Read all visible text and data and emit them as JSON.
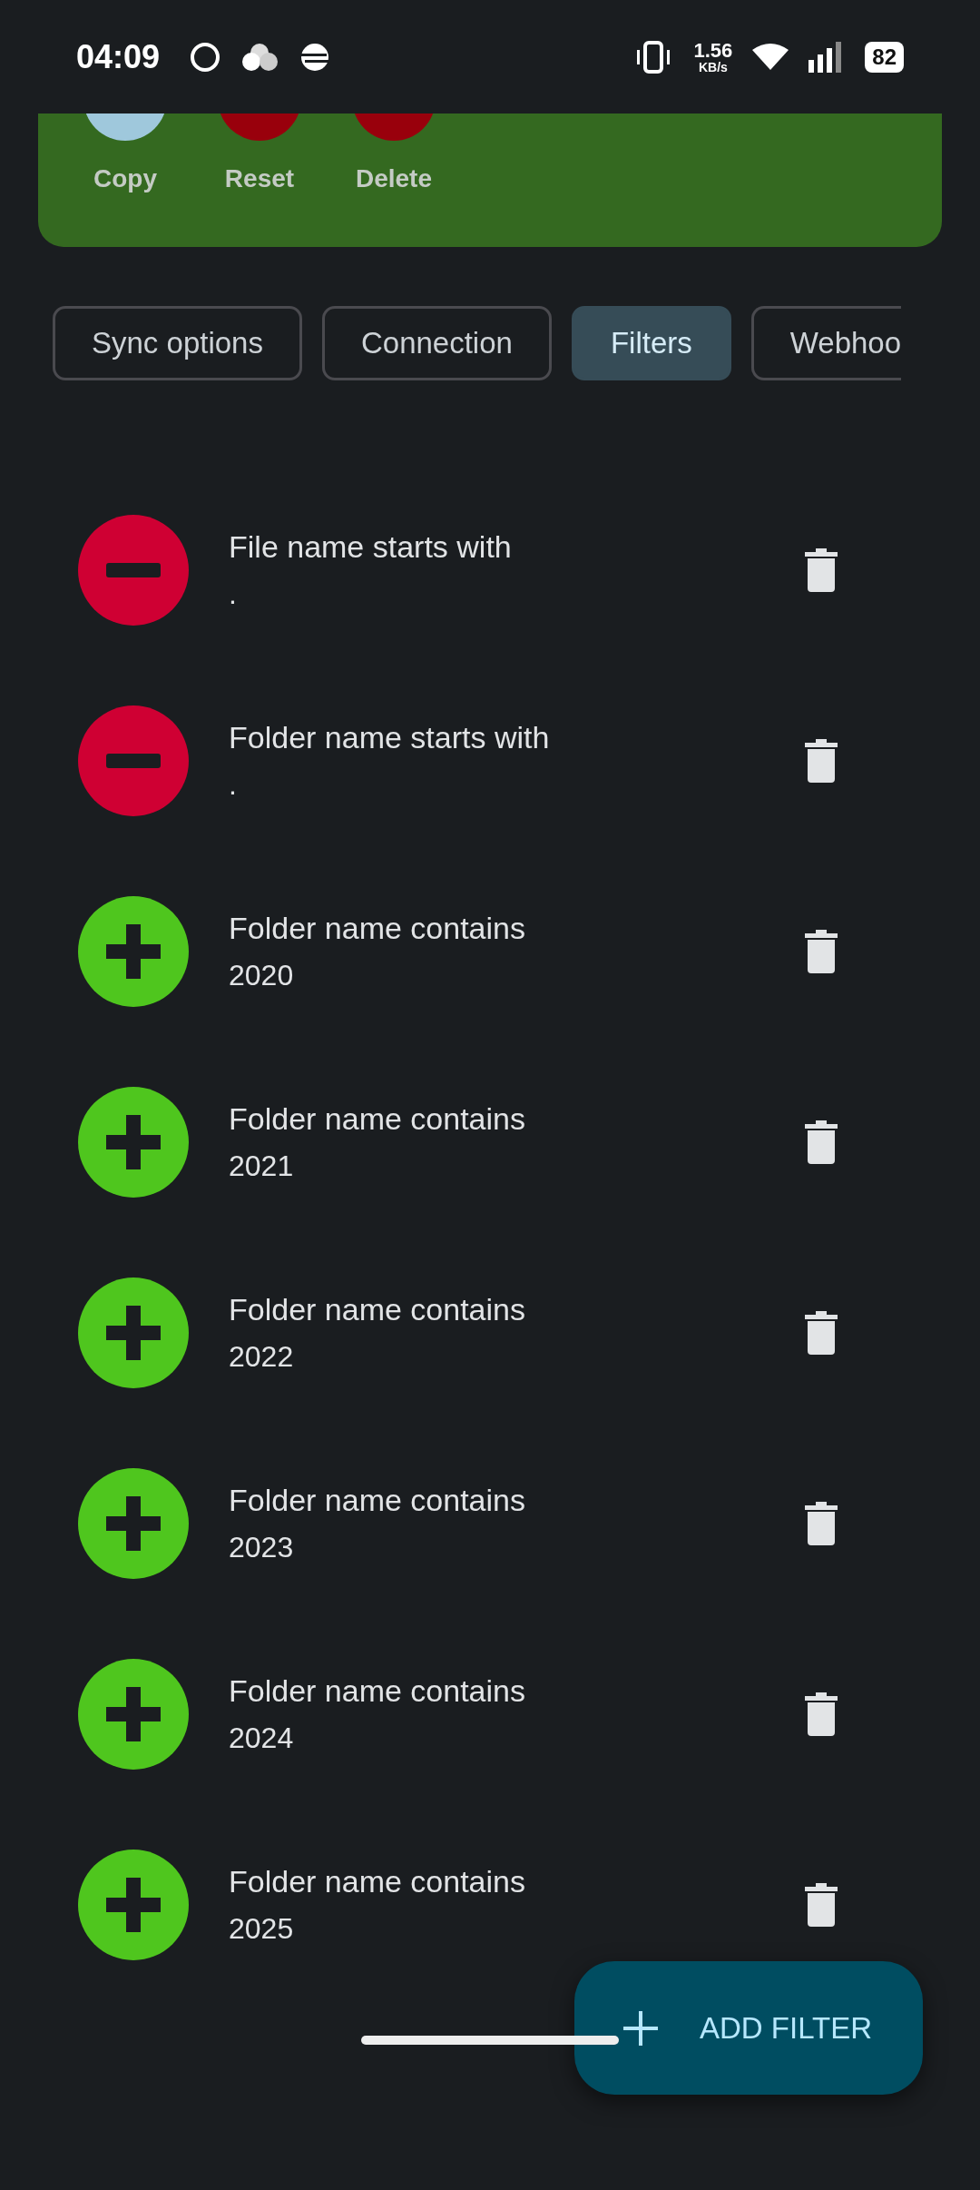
{
  "status_bar": {
    "time": "04:09",
    "speed": "1.56",
    "speed_unit": "KB/s",
    "battery": "82"
  },
  "actions": [
    {
      "label": "Copy",
      "kind": "copy"
    },
    {
      "label": "Reset",
      "kind": "reset"
    },
    {
      "label": "Delete",
      "kind": "delete"
    }
  ],
  "tabs": [
    {
      "label": "Sync options",
      "selected": false
    },
    {
      "label": "Connection",
      "selected": false
    },
    {
      "label": "Filters",
      "selected": true
    },
    {
      "label": "Webhoo",
      "selected": false
    }
  ],
  "filters": [
    {
      "kind": "exclude",
      "title": "File name starts with",
      "value": "."
    },
    {
      "kind": "exclude",
      "title": "Folder name starts with",
      "value": "."
    },
    {
      "kind": "include",
      "title": "Folder name contains",
      "value": "2020"
    },
    {
      "kind": "include",
      "title": "Folder name contains",
      "value": "2021"
    },
    {
      "kind": "include",
      "title": "Folder name contains",
      "value": "2022"
    },
    {
      "kind": "include",
      "title": "Folder name contains",
      "value": "2023"
    },
    {
      "kind": "include",
      "title": "Folder name contains",
      "value": "2024"
    },
    {
      "kind": "include",
      "title": "Folder name contains",
      "value": "2025"
    }
  ],
  "fab": {
    "label": "ADD FILTER"
  }
}
